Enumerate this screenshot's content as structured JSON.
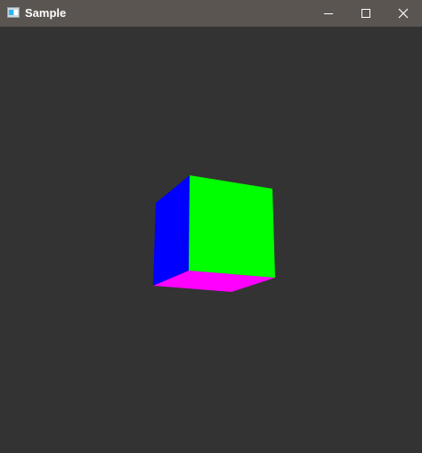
{
  "window": {
    "title": "Sample",
    "icon": "app-window-icon",
    "controls": [
      "minimize-icon",
      "maximize-icon",
      "close-icon"
    ]
  },
  "colors": {
    "titlebar": "#5a5551",
    "viewport_background": "#333333",
    "cube_front": "#00ff00",
    "cube_left": "#0000ff",
    "cube_bottom": "#ff00ff"
  }
}
